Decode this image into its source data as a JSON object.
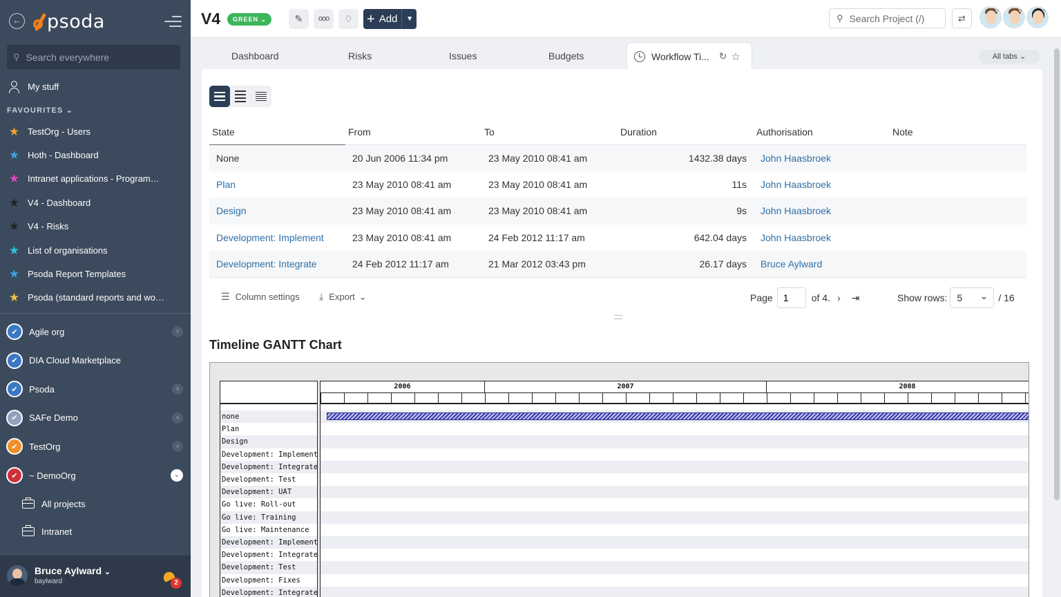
{
  "sidebar": {
    "logo_text": "psoda",
    "search_placeholder": "Search everywhere",
    "my_stuff": "My stuff",
    "favourites_label": "FAVOURITES",
    "favourites": [
      {
        "label": "TestOrg - Users",
        "color": "#f0a030"
      },
      {
        "label": "Hoth - Dashboard",
        "color": "#3fa3e0"
      },
      {
        "label": "Intranet applications - Programme...",
        "color": "#d94cc8"
      },
      {
        "label": "V4 - Dashboard",
        "color": "#222222"
      },
      {
        "label": "V4 - Risks",
        "color": "#222222"
      },
      {
        "label": "List of organisations",
        "color": "#31c2e8"
      },
      {
        "label": "Psoda Report Templates",
        "color": "#3fa3e0"
      },
      {
        "label": "Psoda (standard reports and work...",
        "color": "#f0c040"
      }
    ],
    "orgs": [
      {
        "label": "Agile org",
        "expanded": false,
        "has_children": true,
        "color": "#3b78c4"
      },
      {
        "label": "DIA Cloud Marketplace",
        "expanded": false,
        "has_children": false,
        "color": "#3b78c4"
      },
      {
        "label": "Psoda",
        "expanded": false,
        "has_children": true,
        "color": "#3b78c4"
      },
      {
        "label": "SAFe Demo",
        "expanded": false,
        "has_children": true,
        "color": "#8fa2bd"
      },
      {
        "label": "TestOrg",
        "expanded": false,
        "has_children": true,
        "color": "#f0902a"
      },
      {
        "label": "~ DemoOrg",
        "expanded": true,
        "has_children": true,
        "color": "#d0303a"
      }
    ],
    "sub_items": [
      "All projects",
      "Intranet"
    ],
    "user": {
      "name": "Bruce Aylward",
      "username": "baylward",
      "notifications": "2"
    }
  },
  "topbar": {
    "project_title": "V4",
    "status": "GREEN",
    "add_label": "Add",
    "search_placeholder": "Search Project (/)"
  },
  "tabs": {
    "items": [
      "Dashboard",
      "Risks",
      "Issues",
      "Budgets"
    ],
    "active": "Workflow Ti...",
    "all_tabs": "All tabs"
  },
  "table": {
    "headers": [
      "State",
      "From",
      "To",
      "Duration",
      "Authorisation",
      "Note"
    ],
    "rows": [
      {
        "state": "None",
        "link": false,
        "from": "20 Jun 2006 11:34 pm",
        "to": "23 May 2010 08:41 am",
        "duration": "1432.38 days",
        "auth": "John Haasbroek",
        "note": ""
      },
      {
        "state": "Plan",
        "link": true,
        "from": "23 May 2010 08:41 am",
        "to": "23 May 2010 08:41 am",
        "duration": "11s",
        "auth": "John Haasbroek",
        "note": ""
      },
      {
        "state": "Design",
        "link": true,
        "from": "23 May 2010 08:41 am",
        "to": "23 May 2010 08:41 am",
        "duration": "9s",
        "auth": "John Haasbroek",
        "note": ""
      },
      {
        "state": "Development: Implement",
        "link": true,
        "from": "23 May 2010 08:41 am",
        "to": "24 Feb 2012 11:17 am",
        "duration": "642.04 days",
        "auth": "John Haasbroek",
        "note": ""
      },
      {
        "state": "Development: Integrate",
        "link": true,
        "from": "24 Feb 2012 11:17 am",
        "to": "21 Mar 2012 03:43 pm",
        "duration": "26.17 days",
        "auth": "Bruce Aylward",
        "note": ""
      }
    ],
    "footer": {
      "column_settings": "Column settings",
      "export": "Export",
      "page_label": "Page",
      "page_value": "1",
      "of_label": "of 4.",
      "show_rows_label": "Show rows:",
      "rows_value": "5",
      "total": "/ 16"
    }
  },
  "gantt": {
    "title": "Timeline GANTT Chart",
    "years": [
      {
        "label": "2006",
        "start": "2006-06",
        "months": 7
      },
      {
        "label": "2007",
        "start": "2007-01",
        "months": 12
      },
      {
        "label": "2008",
        "start": "2008-01",
        "months": 12
      }
    ],
    "rows": [
      "none",
      "Plan",
      "Design",
      "Development: Implement",
      "Development: Integrate",
      "Development: Test",
      "Development: UAT",
      "Go live: Roll-out",
      "Go live: Training",
      "Go live: Maintenance",
      "Development: Implement",
      "Development: Integrate",
      "Development: Test",
      "Development: Fixes",
      "Development: Integrate"
    ],
    "bars": [
      {
        "row": 0,
        "from": "2006-06-20",
        "to": "2010-05-23"
      }
    ]
  }
}
